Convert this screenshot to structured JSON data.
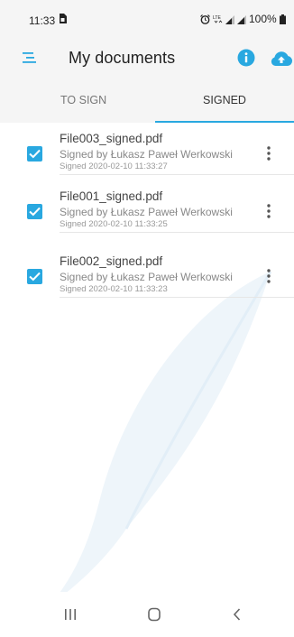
{
  "status_bar": {
    "time": "11:33",
    "battery": "100%",
    "left_icon": "sim-card-icon",
    "right_icons": [
      "alarm-icon",
      "lte-icon",
      "signal-icon",
      "signal-icon",
      "battery-icon"
    ]
  },
  "app_bar": {
    "title": "My documents",
    "menu_icon": "menu-icon",
    "info_icon": "info-icon",
    "upload_icon": "cloud-upload-icon"
  },
  "tabs": [
    {
      "label": "TO SIGN",
      "selected": false
    },
    {
      "label": "SIGNED",
      "selected": true
    }
  ],
  "documents": [
    {
      "name": "File003_signed.pdf",
      "signer": "Signed by Łukasz Paweł Werkowski",
      "date": "Signed 2020-02-10 11:33:27",
      "checked": true
    },
    {
      "name": "File001_signed.pdf",
      "signer": "Signed by Łukasz Paweł Werkowski",
      "date": "Signed 2020-02-10 11:33:25",
      "checked": true
    },
    {
      "name": "File002_signed.pdf",
      "signer": "Signed by Łukasz Paweł Werkowski",
      "date": "Signed 2020-02-10 11:33:23",
      "checked": true
    }
  ],
  "nav_bar": {
    "icons": [
      "recent-apps-icon",
      "home-icon",
      "back-icon"
    ]
  },
  "colors": {
    "accent": "#29a8e0",
    "background": "#ffffff",
    "header": "#f5f5f5"
  }
}
